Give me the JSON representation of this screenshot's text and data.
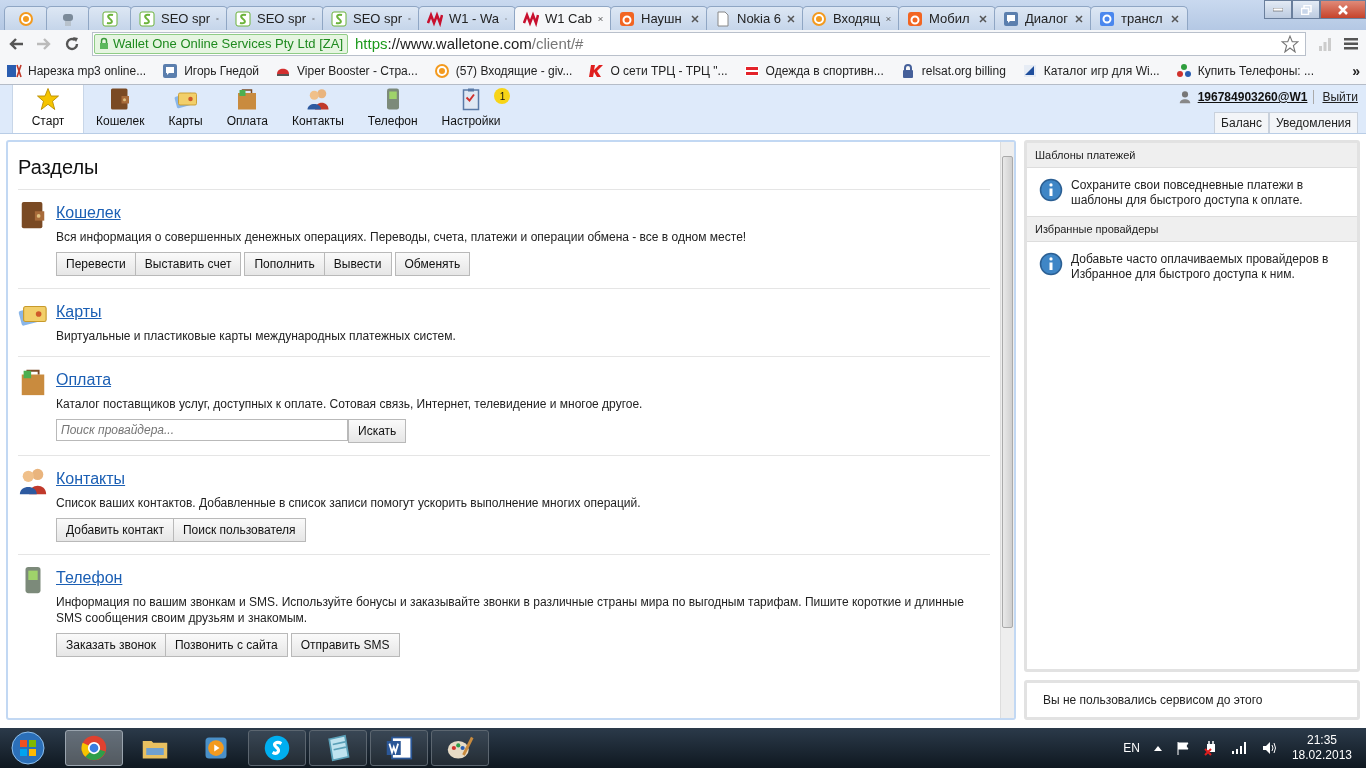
{
  "browser_tabs": [
    {
      "selected": false
    },
    {
      "selected": false
    },
    {
      "selected": false
    },
    {
      "title": "SEO spr",
      "selected": false
    },
    {
      "title": "SEO spr",
      "selected": false
    },
    {
      "title": "SEO spr",
      "selected": false
    },
    {
      "title": "W1 - Wa",
      "selected": false
    },
    {
      "title": "W1 Cab",
      "selected": true
    },
    {
      "title": "Наушн",
      "selected": false
    },
    {
      "title": "Nokia 6",
      "selected": false
    },
    {
      "title": "Входящ",
      "selected": false
    },
    {
      "title": "Мобил",
      "selected": false
    },
    {
      "title": "Диалог",
      "selected": false
    },
    {
      "title": "трансл",
      "selected": false
    }
  ],
  "address_bar": {
    "identity": "Wallet One Online Services Pty Ltd [ZA]",
    "scheme": "https",
    "host": "://www.walletone.com",
    "path": "/client/#"
  },
  "bookmarks": [
    "Нарезка mp3 online...",
    "Игорь Гнедой",
    "Viper Booster - Стра...",
    "(57) Входящие - giv...",
    "О сети ТРЦ - ТРЦ \"...",
    "Одежда в спортивн...",
    "relsat.org billing",
    "Каталог игр для Wi...",
    "Купить Телефоны: ..."
  ],
  "bookmarks_more": "»",
  "app_nav": [
    {
      "label": "Старт",
      "selected": true
    },
    {
      "label": "Кошелек",
      "selected": false
    },
    {
      "label": "Карты",
      "selected": false
    },
    {
      "label": "Оплата",
      "selected": false
    },
    {
      "label": "Контакты",
      "selected": false
    },
    {
      "label": "Телефон",
      "selected": false
    },
    {
      "label": "Настройки",
      "selected": false,
      "badge": "1"
    }
  ],
  "user": {
    "account": "196784903260@W1",
    "logout": "Выйти"
  },
  "sub_tabs": [
    "Баланс",
    "Уведомления"
  ],
  "main": {
    "title": "Разделы",
    "sections": [
      {
        "kind": "buttons",
        "title": "Кошелек",
        "description": "Вся информация о совершенных денежных операциях. Переводы, счета, платежи и операции обмена - все в одном месте!",
        "button_groups": [
          [
            "Перевести",
            "Выставить счет"
          ],
          [
            "Пополнить",
            "Вывести"
          ],
          [
            "Обменять"
          ]
        ]
      },
      {
        "kind": "text",
        "title": "Карты",
        "description": "Виртуальные и пластиковые карты международных платежных систем."
      },
      {
        "kind": "search",
        "title": "Оплата",
        "description": "Каталог поставщиков услуг, доступных к оплате. Сотовая связь, Интернет, телевидение и многое другое.",
        "placeholder": "Поиск провайдера...",
        "search_button": "Искать"
      },
      {
        "kind": "buttons",
        "title": "Контакты",
        "description": "Список ваших контактов. Добавленные в список записи помогут ускорить выполнение многих операций.",
        "button_groups": [
          [
            "Добавить контакт",
            "Поиск пользователя"
          ]
        ]
      },
      {
        "kind": "buttons",
        "title": "Телефон",
        "description": "Информация по вашим звонкам и SMS. Используйте бонусы и заказывайте звонки в различные страны мира по выгодным тарифам. Пишите короткие и длинные SMS сообщения своим друзьям и знакомым.",
        "button_groups": [
          [
            "Заказать звонок",
            "Позвонить с сайта"
          ],
          [
            "Отправить SMS"
          ]
        ]
      }
    ]
  },
  "side_panels": [
    {
      "title": "Шаблоны платежей",
      "text": "Сохраните свои повседневные платежи в шаблоны для быстрого доступа к оплате."
    },
    {
      "title": "Избранные провайдеры",
      "text": "Добавьте часто оплачиваемых провайдеров в Избранное для быстрого доступа к ним."
    }
  ],
  "history_note": "Вы не пользовались сервисом до этого",
  "taskbar": {
    "apps": [
      {
        "running": true,
        "selected": true
      },
      {
        "running": false,
        "selected": false
      },
      {
        "running": false,
        "selected": false
      },
      {
        "running": true,
        "selected": false
      },
      {
        "running": true,
        "selected": false
      },
      {
        "running": true,
        "selected": false
      },
      {
        "running": true,
        "selected": false
      }
    ],
    "language": "EN",
    "time": "21:35",
    "date": "18.02.2013"
  }
}
